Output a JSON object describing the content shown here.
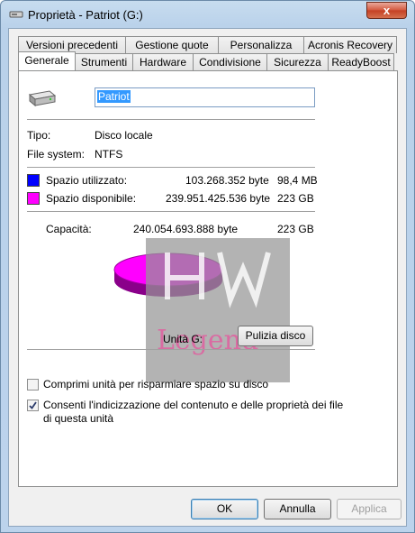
{
  "window": {
    "title": "Proprietà - Patriot (G:)",
    "close_glyph": "x"
  },
  "tabs_back": [
    "Versioni precedenti",
    "Gestione quote",
    "Personalizza",
    "Acronis Recovery"
  ],
  "tabs_front": [
    "Generale",
    "Strumenti",
    "Hardware",
    "Condivisione",
    "Sicurezza",
    "ReadyBoost"
  ],
  "drive": {
    "icon": "drive-icon",
    "name": "Patriot"
  },
  "info": {
    "type_label": "Tipo:",
    "type_value": "Disco locale",
    "fs_label": "File system:",
    "fs_value": "NTFS"
  },
  "space": {
    "used_label": "Spazio utilizzato:",
    "used_bytes": "103.268.352 byte",
    "used_human": "98,4 MB",
    "used_color": "#0000ff",
    "free_label": "Spazio disponibile:",
    "free_bytes": "239.951.425.536 byte",
    "free_human": "223 GB",
    "free_color": "#ff00ff",
    "cap_label": "Capacità:",
    "cap_bytes": "240.054.693.888 byte",
    "cap_human": "223 GB",
    "used_fraction": 0.0004
  },
  "drive_label": "Unità G:",
  "cleanup_button": "Pulizia disco",
  "watermark_text": "Legend",
  "options": {
    "compress_label": "Comprimi unità per risparmiare spazio su disco",
    "compress_checked": false,
    "index_label_1": "Consenti l'indicizzazione del contenuto e delle proprietà dei file",
    "index_label_2": "di questa unità",
    "index_checked": true
  },
  "buttons": {
    "ok": "OK",
    "cancel": "Annulla",
    "apply": "Applica"
  }
}
